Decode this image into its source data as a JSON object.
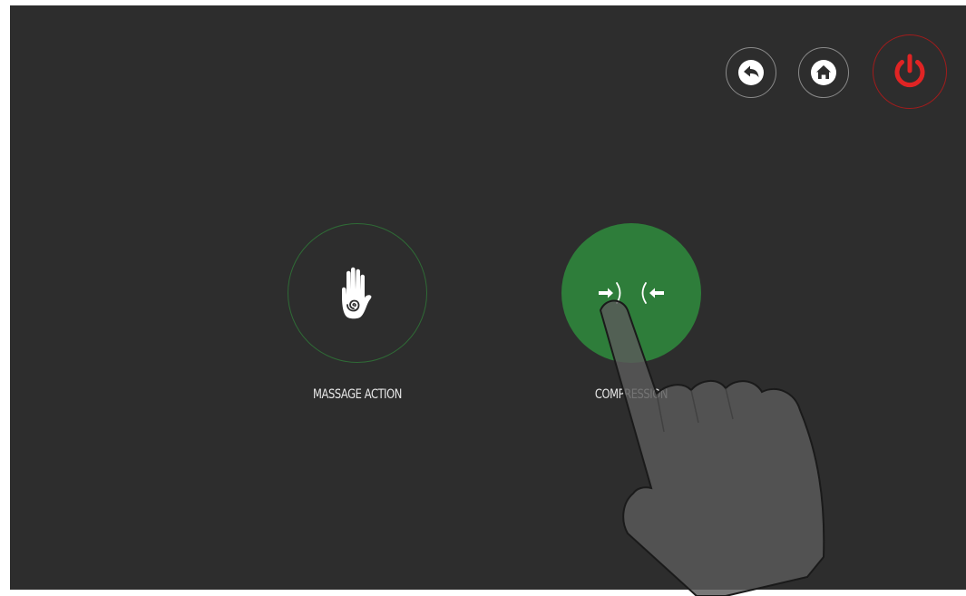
{
  "topbar": {
    "back": {
      "icon": "back-arrow-icon"
    },
    "home": {
      "icon": "home-icon"
    },
    "power": {
      "icon": "power-icon",
      "color": "#e02424"
    }
  },
  "modes": [
    {
      "label": "MASSAGE ACTION",
      "icon": "hand-spiral-icon",
      "selected": false,
      "color": "#2f6b36"
    },
    {
      "label": "COMPRESSION",
      "icon": "compression-arrows-icon",
      "selected": true,
      "color": "#2e7d3a"
    }
  ],
  "overlay": {
    "icon": "pointing-hand-icon"
  }
}
